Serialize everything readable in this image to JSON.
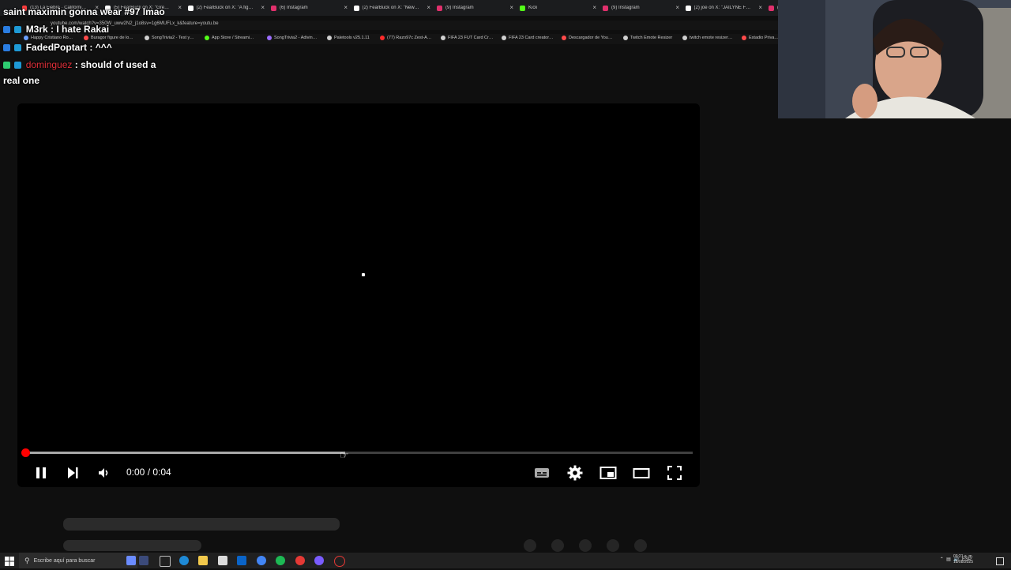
{
  "browser": {
    "tabs": [
      {
        "label": "(13) La Fiebre · California Lo…",
        "favicon_color": "#ff3d3d"
      },
      {
        "label": "(5) FearBuck on X: \"Grea…",
        "favicon_color": "#ffffff"
      },
      {
        "label": "(2) FearBuck on X: \"A fight…",
        "favicon_color": "#ffffff"
      },
      {
        "label": "(6) Instagram",
        "favicon_color": "#e1306c"
      },
      {
        "label": "(2) FearBuck on X: \"New p…",
        "favicon_color": "#ffffff"
      },
      {
        "label": "(9) Instagram",
        "favicon_color": "#e1306c"
      },
      {
        "label": "Kick",
        "favicon_color": "#53fc18"
      },
      {
        "label": "(9) Instagram",
        "favicon_color": "#e1306c"
      },
      {
        "label": "(2) joe on X: \"JAILYNE FRI…",
        "favicon_color": "#ffffff"
      },
      {
        "label": "(9)",
        "favicon_color": "#e1306c"
      }
    ],
    "url": "youtube.com/watch?v=350W_uww2N2_j1o8sv=1g6MUFLx_k&feature=youtu.be",
    "bookmarks": [
      {
        "label": "Happy Cristiano Ro…",
        "color": "#6aa0ff"
      },
      {
        "label": "Buragor figure de lo…",
        "color": "#ff4a4a"
      },
      {
        "label": "SongTrivia2 - Test y…",
        "color": "#cfcfcf"
      },
      {
        "label": "App Store / Streami…",
        "color": "#53fc18"
      },
      {
        "label": "SongTrivia2 - Adivin…",
        "color": "#9b6cff"
      },
      {
        "label": "Paletools v25.1.11",
        "color": "#cfcfcf"
      },
      {
        "label": "(77) Razo97c Zest-A…",
        "color": "#ff2b2b"
      },
      {
        "label": "FIFA 23 FUT Card Cr…",
        "color": "#cfcfcf"
      },
      {
        "label": "FIFA 23 Card creator…",
        "color": "#cfcfcf"
      },
      {
        "label": "Descargador de You…",
        "color": "#ff4a4a"
      },
      {
        "label": "Twitch Emote Resizer",
        "color": "#cfcfcf"
      },
      {
        "label": "twitch emote resizer…",
        "color": "#cfcfcf"
      },
      {
        "label": "Estadio Priva…",
        "color": "#ff4a4a"
      }
    ]
  },
  "chat": [
    {
      "user": "",
      "text": "saint maximin gonna wear #97 lmao",
      "color": "#ffffff"
    },
    {
      "user": "M3rk",
      "text": ": I hate Rakai",
      "color": "#ffffff"
    },
    {
      "user": "FadedPoptart",
      "text": ": ^^^",
      "color": "#ffffff"
    },
    {
      "user": "dominguez",
      "text": ": should of used a",
      "color": "#e0303a"
    },
    {
      "user": "",
      "text": "real one",
      "color": "#ffffff"
    }
  ],
  "player": {
    "time_label": "0:00 / 0:04",
    "played_fraction": 0.0,
    "loaded_fraction": 0.48,
    "accent": "#ff0000",
    "controls": {
      "play_pause_icon": "pause-icon",
      "next_icon": "next-icon",
      "volume_icon": "volume-icon",
      "subtitles_icon": "subtitles-icon",
      "settings_icon": "settings-icon",
      "miniplayer_icon": "miniplayer-icon",
      "theater_icon": "theater-icon",
      "fullscreen_icon": "fullscreen-icon"
    }
  },
  "taskbar": {
    "search_placeholder": "Escribe aquí para buscar",
    "language": "ESP",
    "clock_time": "03:21 a. m.",
    "clock_date": "18/08/2025"
  }
}
